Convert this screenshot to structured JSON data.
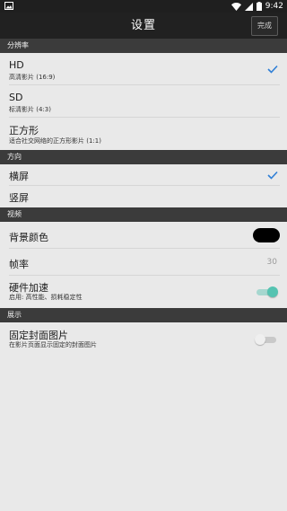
{
  "status_bar": {
    "time": "9:42",
    "icons": [
      "image-icon",
      "wifi-icon",
      "signal-icon",
      "battery-icon"
    ]
  },
  "action_bar": {
    "title": "设置",
    "done_label": "完成"
  },
  "colors": {
    "accent": "#2f7fd6",
    "toggle_on": "#55c3b1",
    "section_bg": "#3b3b3b",
    "action_bar_bg": "#212121",
    "background": "#e9e9e9"
  },
  "sections": {
    "resolution": {
      "header": "分辨率",
      "items": [
        {
          "title": "HD",
          "subtitle": "高清影片 (16:9)",
          "selected": true
        },
        {
          "title": "SD",
          "subtitle": "标清影片 (4:3)",
          "selected": false
        },
        {
          "title": "正方形",
          "subtitle": "适合社交网络的正方形影片 (1:1)",
          "selected": false
        }
      ]
    },
    "orientation": {
      "header": "方向",
      "items": [
        {
          "title": "横屏",
          "selected": true
        },
        {
          "title": "竖屏",
          "selected": false
        }
      ]
    },
    "video": {
      "header": "视频",
      "background_color": {
        "title": "背景颜色",
        "color": "#000000"
      },
      "frame_rate": {
        "title": "帧率",
        "value": "30"
      },
      "hardware_acceleration": {
        "title": "硬件加速",
        "subtitle": "启用: 高性能、损耗稳定性",
        "enabled": true
      }
    },
    "display": {
      "header": "展示",
      "fixed_cover": {
        "title": "固定封面图片",
        "subtitle": "在影片页面显示固定的封面图片",
        "enabled": false
      }
    }
  }
}
